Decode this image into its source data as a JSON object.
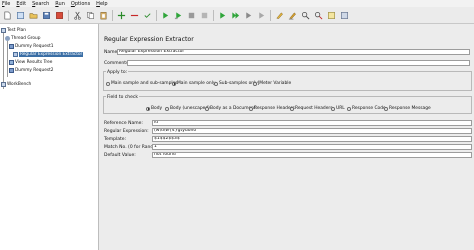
{
  "menu": [
    {
      "key": "F",
      "rest": "ile"
    },
    {
      "key": "E",
      "rest": "dit"
    },
    {
      "key": "S",
      "rest": "earch"
    },
    {
      "key": "R",
      "rest": "un"
    },
    {
      "key": "O",
      "rest": "ptions"
    },
    {
      "key": "H",
      "rest": "elp"
    }
  ],
  "tree": {
    "test_plan": "Test Plan",
    "thread_group": "Thread Group",
    "request1": "Dummy Request1",
    "extractor": "Regular Expression Extractor",
    "view_results": "View Results Tree",
    "request2": "Dummy Request2",
    "workbench": "WorkBench"
  },
  "panel": {
    "title": "Regular Expression Extractor",
    "name_label": "Name:",
    "name_value": "Regular Expression Extractor",
    "comments_label": "Comments:",
    "comments_value": "",
    "apply_to_label": "Apply to:",
    "apply_options": [
      "Main sample and sub-samples",
      "Main sample only",
      "Sub-samples only",
      "JMeter Variable"
    ],
    "apply_selected": 1,
    "field_to_check_label": "Field to check",
    "check_options": [
      "Body",
      "Body (unescaped)",
      "Body as a Document",
      "Response Headers",
      "Request Headers",
      "URL",
      "Response Code",
      "Response Message"
    ],
    "check_selected": 0,
    "ref_name_label": "Reference Name:",
    "ref_name_value": "id",
    "regex_label": "Regular Expression:",
    "regex_value": "(w\\d\\w{4}gtyuoho",
    "template_label": "Template:",
    "template_value": "$1$$2$$3$",
    "match_label": "Match No. (0 for Random):",
    "match_value": "1",
    "default_label": "Default Value:",
    "default_value": "not found"
  }
}
